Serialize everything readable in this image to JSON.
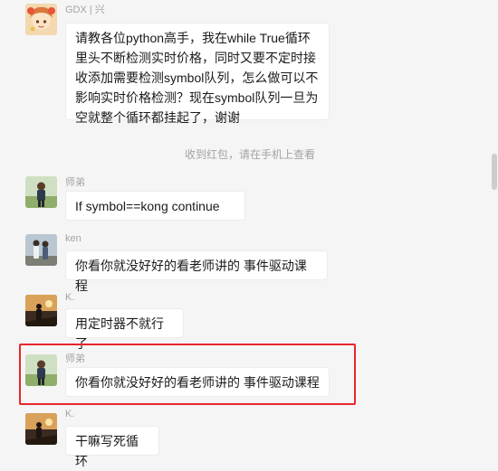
{
  "messages": [
    {
      "sender": "GDX | 兴",
      "text": "请教各位python高手，我在while True循环\n里头不断检测实时价格，同时又要不定时接\n收添加需要检测symbol队列，怎么做可以不\n影响实时价格检测？现在symbol队列一旦为\n空就整个循环都挂起了，谢谢"
    },
    {
      "sender": "师弟",
      "text": "If symbol==kong continue"
    },
    {
      "sender": "ken",
      "text": "你看你就没好好的看老师讲的 事件驱动课程"
    },
    {
      "sender": "K.",
      "text": "用定时器不就行了"
    },
    {
      "sender": "师弟",
      "text": "你看你就没好好的看老师讲的 事件驱动课程"
    },
    {
      "sender": "K.",
      "text": "干嘛写死循环"
    }
  ],
  "system_note": "收到红包，请在手机上查看",
  "highlight_color": "#e8262b",
  "icons": [
    "avatar-anime-girl",
    "avatar-man-outdoor",
    "avatar-two-people",
    "avatar-man-sunset"
  ]
}
